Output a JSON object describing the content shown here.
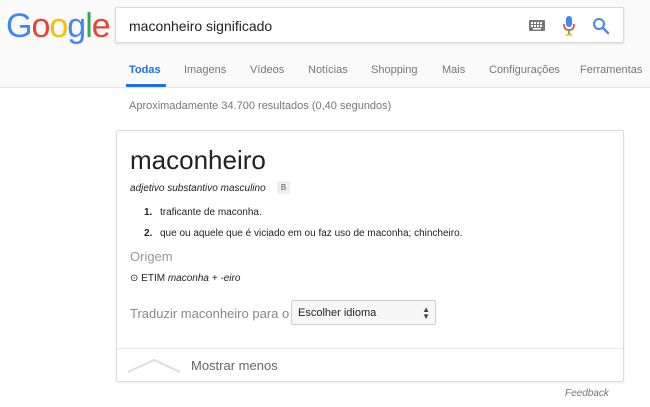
{
  "logo": {
    "letters": [
      "G",
      "o",
      "o",
      "g",
      "l",
      "e"
    ],
    "colors": [
      "#4285F4",
      "#EA4335",
      "#FBBC05",
      "#4285F4",
      "#34A853",
      "#EA4335"
    ]
  },
  "search": {
    "value": "maconheiro significado",
    "icons": {
      "keyboard": "keyboard-icon",
      "mic": "mic-icon",
      "search": "search-icon"
    }
  },
  "tabs": [
    {
      "label": "Todas",
      "active": true
    },
    {
      "label": "Imagens"
    },
    {
      "label": "Vídeos"
    },
    {
      "label": "Notícias"
    },
    {
      "label": "Shopping"
    },
    {
      "label": "Mais"
    },
    {
      "label": "Configurações"
    },
    {
      "label": "Ferramentas"
    }
  ],
  "result_stats": "Aproximadamente 34.700 resultados (0,40 segundos)",
  "definition": {
    "word": "maconheiro",
    "part_of_speech": "adjetivo substantivo masculino",
    "badge": "B",
    "senses": [
      {
        "num": "1.",
        "text": "traficante de maconha."
      },
      {
        "num": "2.",
        "text": "que ou aquele que é viciado em ou faz uso de maconha; chincheiro."
      }
    ],
    "origin_heading": "Origem",
    "etymology": {
      "symbol": "⊙",
      "prefix": "ETIM",
      "source": "maconha + -eiro"
    }
  },
  "translate": {
    "label": "Traduzir maconheiro para o",
    "select_value": "Escolher idioma"
  },
  "show_less": "Mostrar menos",
  "feedback": "Feedback",
  "colors": {
    "accent": "#1a73e8",
    "muted": "#777777"
  }
}
